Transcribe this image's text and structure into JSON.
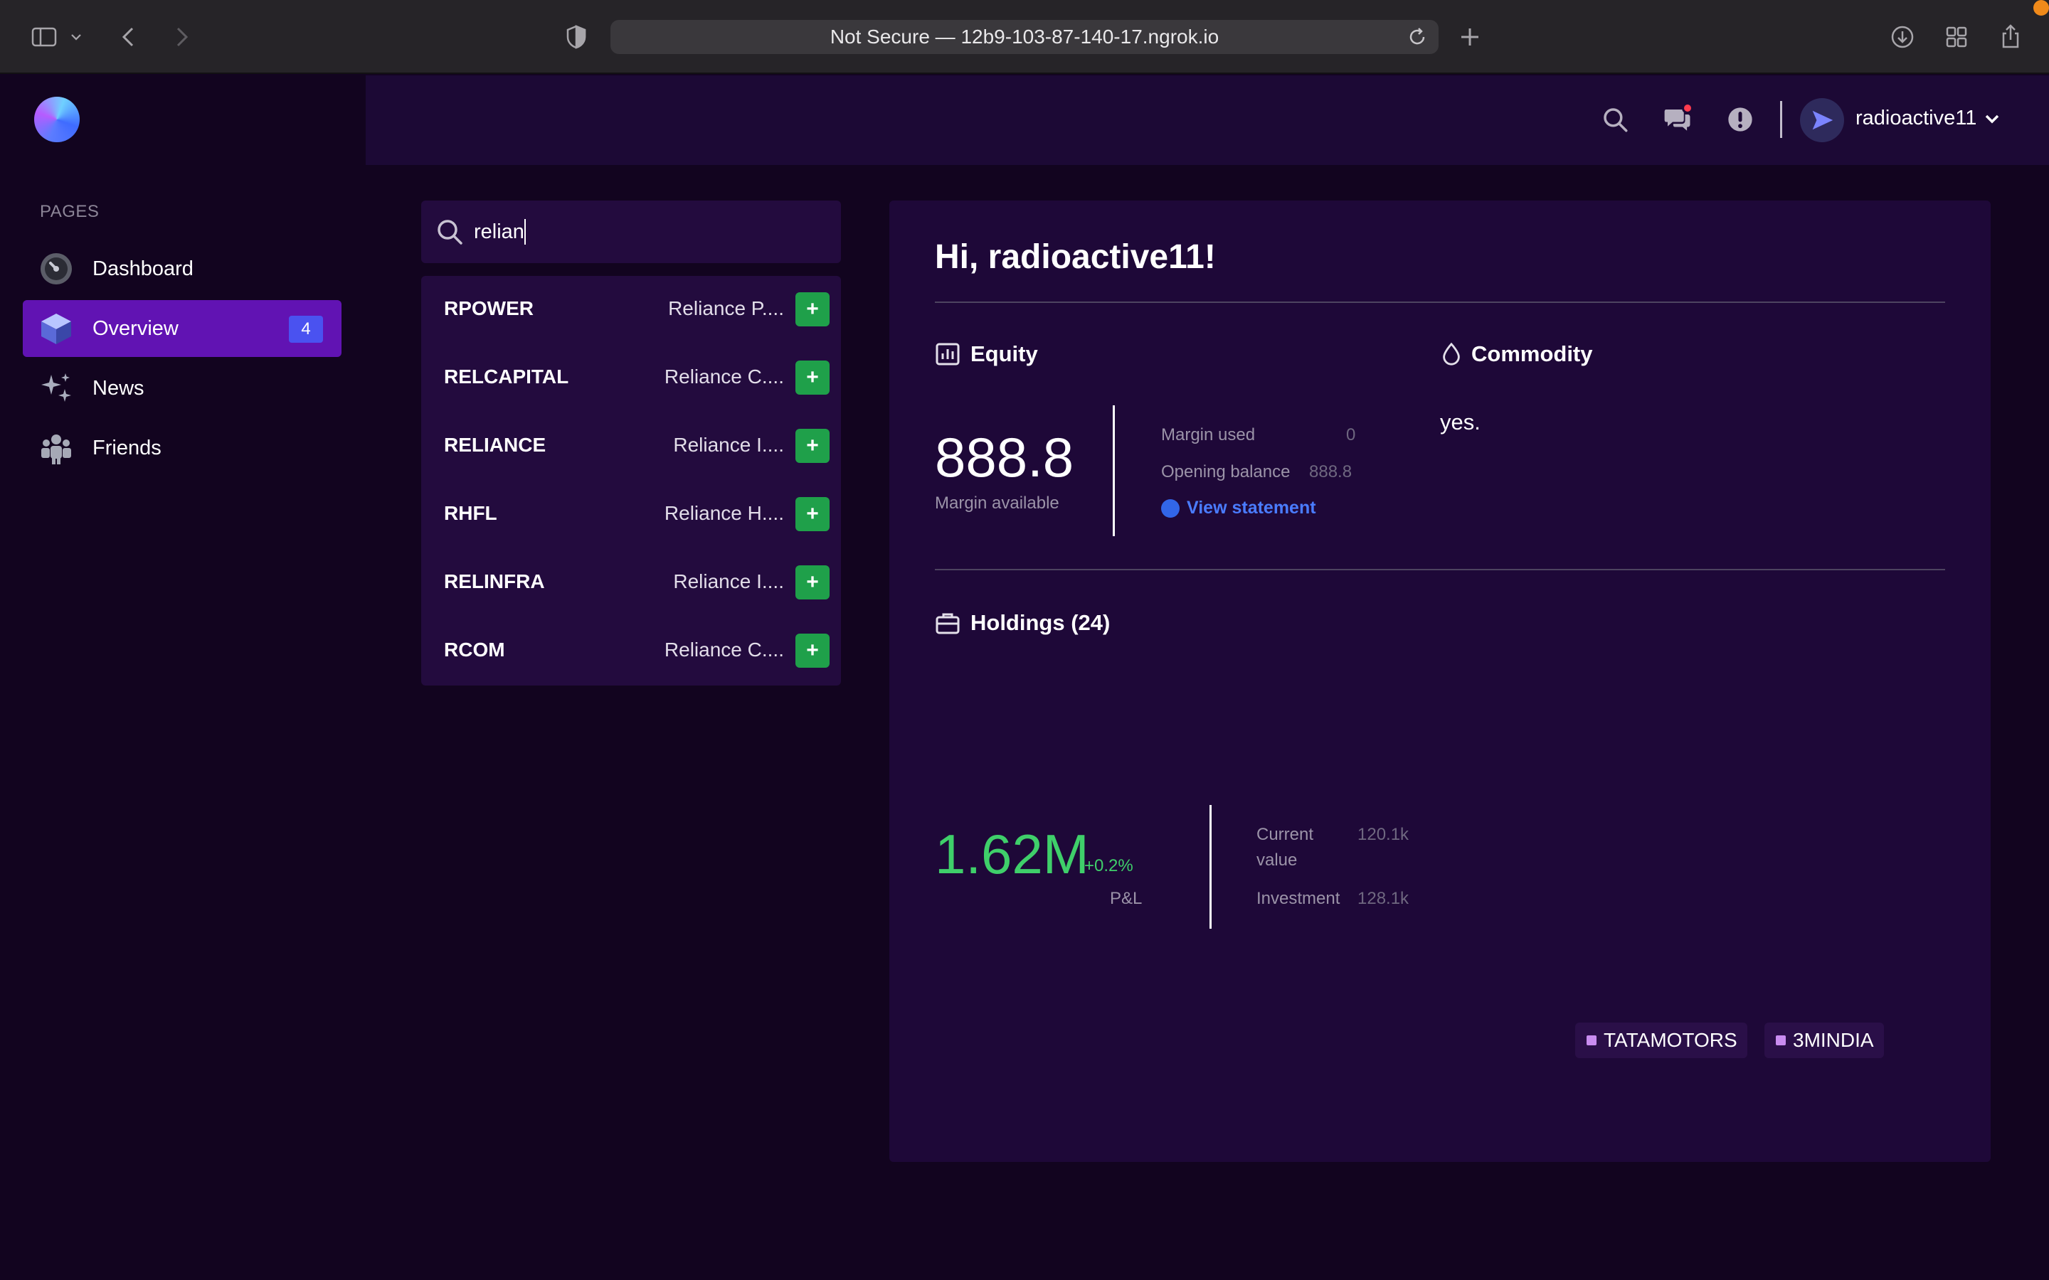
{
  "browser": {
    "url_text": "Not Secure — 12b9-103-87-140-17.ngrok.io"
  },
  "sidebar": {
    "heading": "PAGES",
    "items": [
      {
        "label": "Dashboard",
        "icon": "dashboard-icon"
      },
      {
        "label": "Overview",
        "icon": "cube-icon",
        "badge": "4",
        "active": true
      },
      {
        "label": "News",
        "icon": "sparkle-icon"
      },
      {
        "label": "Friends",
        "icon": "people-icon"
      }
    ]
  },
  "header": {
    "username": "radioactive11"
  },
  "search": {
    "value": "relian",
    "results": [
      {
        "symbol": "RPOWER",
        "name": "Reliance P...."
      },
      {
        "symbol": "RELCAPITAL",
        "name": "Reliance C...."
      },
      {
        "symbol": "RELIANCE",
        "name": "Reliance I...."
      },
      {
        "symbol": "RHFL",
        "name": "Reliance H...."
      },
      {
        "symbol": "RELINFRA",
        "name": "Reliance I...."
      },
      {
        "symbol": "RCOM",
        "name": "Reliance C...."
      }
    ],
    "add_label": "+"
  },
  "main": {
    "greeting": "Hi, radioactive11!",
    "equity": {
      "title": "Equity",
      "margin_available": "888.8",
      "margin_available_label": "Margin available",
      "margin_used_label": "Margin used",
      "margin_used": "0",
      "opening_balance_label": "Opening balance",
      "opening_balance": "888.8",
      "view_statement": "View statement"
    },
    "commodity": {
      "title": "Commodity",
      "text": "yes."
    },
    "holdings": {
      "title": "Holdings (24)",
      "pnl": "1.62M",
      "pnl_change": "+0.2%",
      "pnl_label": "P&L",
      "current_value_label_1": "Current",
      "current_value_label_2": "value",
      "current_value": "120.1k",
      "investment_label": "Investment",
      "investment": "128.1k",
      "tags": [
        "TATAMOTORS",
        "3MINDIA"
      ]
    }
  },
  "colors": {
    "background": "#12041f",
    "panel": "#1e0838",
    "active_nav": "#6113b3",
    "badge": "#4a52f0",
    "add_button": "#1fa04a",
    "pnl_green": "#3fcf6a",
    "link": "#4a7cff"
  }
}
